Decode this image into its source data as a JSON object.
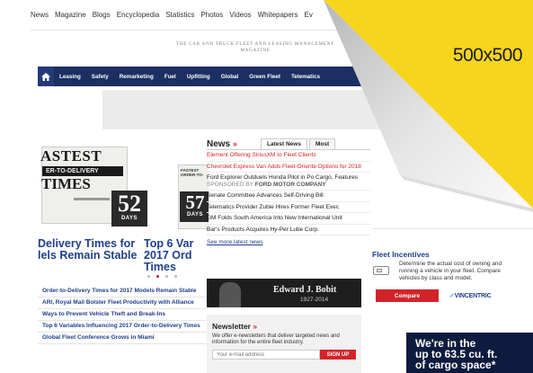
{
  "topnav": [
    "News",
    "Magazine",
    "Blogs",
    "Encyclopedia",
    "Statistics",
    "Photos",
    "Videos",
    "Whitepapers",
    "Ev"
  ],
  "tagline": "THE CAR AND TRUCK FLEET AND LEASING MANAGEMENT MAGAZINE",
  "mainnav": [
    "Leasing",
    "Safety",
    "Remarketing",
    "Fuel",
    "Upfitting",
    "Global",
    "Green Fleet",
    "Telematics"
  ],
  "hero": {
    "slate_top": "ASTEST",
    "slate_band": "ER-TO-DELIVERY",
    "slate_bottom": "TIMES",
    "days1": "52",
    "days2": "57",
    "days_label": "DAYS",
    "slate2_text": "FASTEST ORDER-TO-",
    "headline1_line1": "Delivery Times for",
    "headline1_line2": "lels Remain Stable",
    "headline2_line1": "Top 6 Var",
    "headline2_line2": "2017 Ord",
    "headline2_line3": "Times"
  },
  "stories": [
    "Order-to-Delivery Times for 2017 Models Remain Stable",
    "ARI, Royal Mail Bolster Fleet Productivity with Alliance",
    "Ways to Prevent Vehicle Theft and Break-Ins",
    "Top 6 Variables Influencing 2017 Order-to-Delivery Times",
    "Global Fleet Conference Grows in Miami"
  ],
  "news": {
    "title": "News",
    "chevron": "»",
    "tabs": [
      "Latest News",
      "Most"
    ],
    "items": [
      {
        "text": "Element Offering SiriusXM to Fleet Clients",
        "style": "red"
      },
      {
        "text": "Chevrolet Express Van Adds Fleet-Oriente Options for 2018",
        "style": "red"
      },
      {
        "text": "Ford Explorer Outduels Honda Pilot in Po Cargo, Features",
        "style": "normal"
      },
      {
        "text": "Senate Committee Advances Self-Driving Bill",
        "style": "normal"
      },
      {
        "text": "Telematics Provider Zubie Hires Former Fleet Exec",
        "style": "normal"
      },
      {
        "text": "GM Folds South America Into New International Unit",
        "style": "normal"
      },
      {
        "text": "Bar's Products Acquires Hy-Per Lube Corp.",
        "style": "normal"
      }
    ],
    "sponsored_prefix": "SPONSORED BY",
    "sponsored_name": "FORD MOTOR COMPANY",
    "see_all": "See more latest news"
  },
  "bobit": {
    "name": "Edward J. Bobit",
    "years": "1927-2014"
  },
  "newsletter": {
    "title": "Newsletter",
    "chevron": "»",
    "text": "We offer e-newsletters that deliver targeted news and information for the entire fleet industry.",
    "placeholder": "Your e-mail address",
    "button": "SIGN UP"
  },
  "fleet_incentives": {
    "title": "Fleet Incentives",
    "text": "Determine the actual cost of owning and running a vehicle in your fleet. Compare vehicles by class and model.",
    "button": "Compare",
    "partner_a": "VINCENTRIC"
  },
  "ad": {
    "line1": "We're in the",
    "line2": "up to 63.5 cu. ft.",
    "line3": "of cargo space*"
  },
  "overlay": {
    "size_label": "500x500"
  },
  "colors": {
    "nav": "#1b2f63",
    "accent": "#d3232a",
    "link": "#1f3f8a",
    "peel_yellow": "#f7d51d"
  }
}
